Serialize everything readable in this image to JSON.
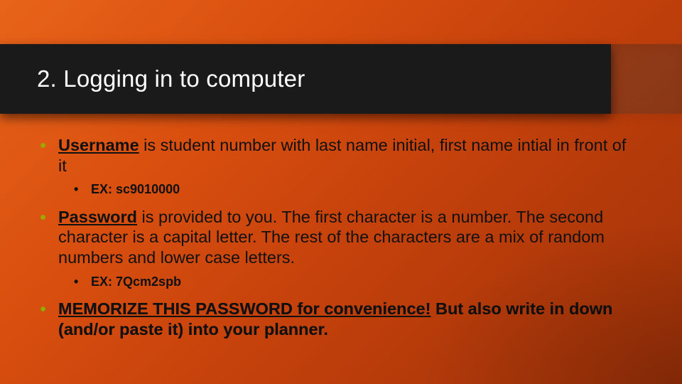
{
  "title": "2.  Logging in to computer",
  "bullets": {
    "username": {
      "label": "Username",
      "rest": " is student number with last name initial, first name intial in front of it",
      "example_prefix": "EX:  ",
      "example_value": "sc9010000"
    },
    "password": {
      "label": "Password",
      "rest": " is provided to you.  The first character is a number. The second character is a capital letter.  The rest of the characters are a mix of random numbers and lower case letters.",
      "example_prefix": "EX:  ",
      "example_value": "7Qcm2spb"
    },
    "memorize": {
      "part1": "MEMORIZE THIS PASSWORD for convenience!",
      "part2": "  But also write in down (and/or paste it) into your planner."
    }
  }
}
